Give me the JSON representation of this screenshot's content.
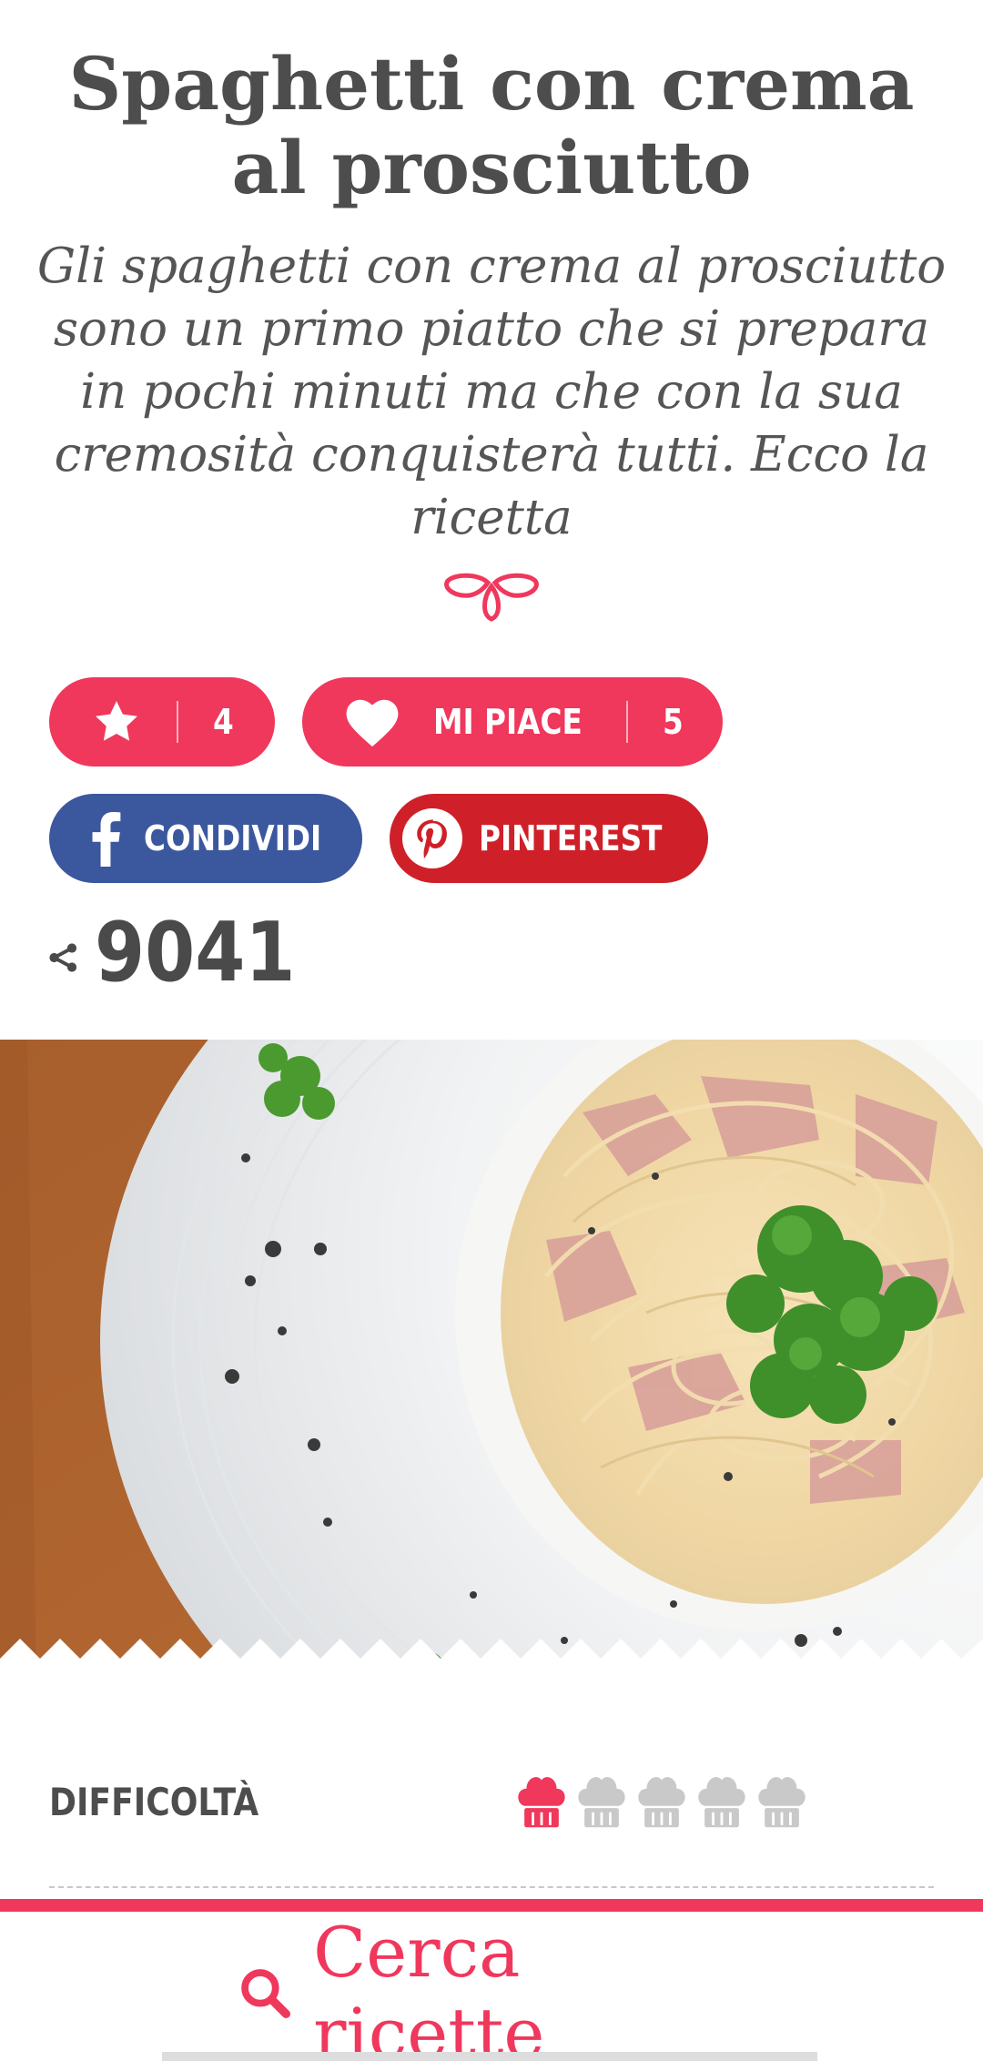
{
  "recipe": {
    "title": "Spaghetti con crema al prosciutto",
    "subtitle": "Gli spaghetti con crema al prosciutto sono un primo piatto che si prepara in pochi minuti ma che con la sua cremosità conquisterà tutti. Ecco la ricetta"
  },
  "actions": {
    "rating_value": "4",
    "like_label": "MI PIACE",
    "like_count": "5",
    "facebook_label": "CONDIVIDI",
    "pinterest_label": "PINTEREST"
  },
  "shares": {
    "count": "9041"
  },
  "details": {
    "difficulty_label": "DIFFICOLTÀ",
    "difficulty_level": 1,
    "difficulty_max": 5
  },
  "bottom_bar": {
    "search_label": "Cerca ricette"
  },
  "colors": {
    "accent": "#f0375c",
    "facebook": "#3b579d",
    "pinterest": "#cf2029",
    "inactive_hat": "#c9c9c9"
  },
  "icons": {
    "rating": "star-icon",
    "like": "heart-icon",
    "facebook": "facebook-icon",
    "pinterest": "pinterest-icon",
    "share": "share-icon",
    "difficulty": "chef-hat-icon",
    "search": "search-icon"
  }
}
